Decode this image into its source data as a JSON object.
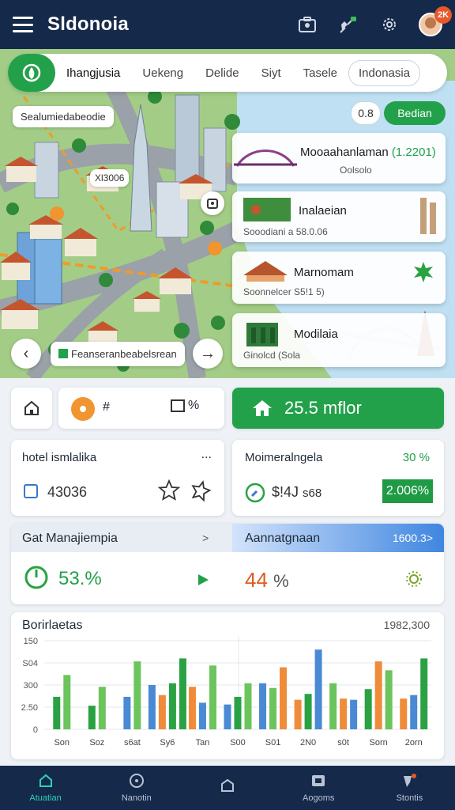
{
  "app": {
    "title": "Sldonoia"
  },
  "header": {
    "icons": [
      "briefcase-icon",
      "satellite-icon",
      "gear-icon"
    ],
    "avatar_badge": "2K"
  },
  "map": {
    "tabs": [
      "Ihangjusia",
      "Uekeng",
      "Delide",
      "Siyt",
      "Tasele",
      "Indonasia"
    ],
    "top_label": "Sealumiedabeodie",
    "marker_label": "Xl3006",
    "bottom_label": "Feanseranbeabelsrean",
    "pill_left": "0.8",
    "pill_right": "Bedian",
    "cards": [
      {
        "title": "Mooaahanlaman",
        "price": "(1.2201)",
        "sub": "Oolsolo"
      },
      {
        "title": "Inalaeian",
        "sub": "Sooodiani a 58.0.06"
      },
      {
        "title": "Marnomam",
        "sub": "Soonnelcer S5!1 5)"
      },
      {
        "title": "Modilaia",
        "sub": "Ginolcd (Sola"
      }
    ]
  },
  "quick": {
    "toolbar_a": "#",
    "toolbar_b": "%",
    "budget": "25.5 mflor"
  },
  "hotel_card": {
    "title": "hotel ismlalika",
    "more": "...",
    "code": "43036"
  },
  "metric_card": {
    "title": "Moimeralngela",
    "pct": "30 %",
    "price": "$!4J",
    "unit": "s68",
    "badge": "2.006%"
  },
  "stat_row": {
    "left_title": "Gat Manajiempia",
    "left_chev": ">",
    "left_value": "53.%",
    "right_title": "Aannatgnaan",
    "right_value": "1600.3",
    "right_chev": ">",
    "right_metric": "44",
    "right_unit": "%"
  },
  "chart": {
    "title": "Borirlaetas",
    "meta": "1982,300",
    "chart_data": {
      "type": "bar",
      "title": "Borirlaetas",
      "y_tick_labels": [
        "150",
        "S04",
        "300",
        "2.50",
        "0"
      ],
      "x_tick_labels": [
        "Son",
        "Soz",
        "s6at",
        "Sy6",
        "Tan",
        "S00",
        "S01",
        "2N0",
        "s0t",
        "Sorn",
        "2orn"
      ],
      "ylim": [
        0,
        150
      ],
      "colors": {
        "dark_green": "#2aa243",
        "light_green": "#6cc45c",
        "blue": "#4a89d4",
        "orange": "#ef8c3a"
      },
      "groups": [
        {
          "bars": [
            [
              "dark_green",
              55
            ],
            [
              "light_green",
              92
            ]
          ]
        },
        {
          "bars": [
            [
              "dark_green",
              40
            ],
            [
              "light_green",
              72
            ]
          ]
        },
        {
          "bars": [
            [
              "blue",
              55
            ],
            [
              "light_green",
              115
            ]
          ]
        },
        {
          "bars": [
            [
              "blue",
              75
            ],
            [
              "orange",
              58
            ],
            [
              "dark_green",
              78
            ],
            [
              "dark_green",
              120
            ]
          ]
        },
        {
          "bars": [
            [
              "orange",
              72
            ],
            [
              "blue",
              45
            ],
            [
              "light_green",
              108
            ]
          ]
        },
        {
          "bars": [
            [
              "blue",
              42
            ],
            [
              "dark_green",
              55
            ],
            [
              "light_green",
              78
            ]
          ]
        },
        {
          "bars": [
            [
              "blue",
              78
            ],
            [
              "light_green",
              70
            ],
            [
              "orange",
              105
            ]
          ]
        },
        {
          "bars": [
            [
              "orange",
              50
            ],
            [
              "dark_green",
              60
            ],
            [
              "blue",
              135
            ]
          ]
        },
        {
          "bars": [
            [
              "light_green",
              78
            ],
            [
              "orange",
              52
            ],
            [
              "blue",
              50
            ]
          ]
        },
        {
          "bars": [
            [
              "dark_green",
              68
            ],
            [
              "orange",
              115
            ],
            [
              "light_green",
              100
            ]
          ]
        },
        {
          "bars": [
            [
              "orange",
              52
            ],
            [
              "blue",
              58
            ],
            [
              "dark_green",
              120
            ]
          ]
        }
      ]
    }
  },
  "bottom_nav": [
    {
      "label": "Atuatian",
      "icon": "home-icon",
      "active": true
    },
    {
      "label": "Nanotin",
      "icon": "compass-icon",
      "active": false
    },
    {
      "label": "",
      "icon": "bag-icon",
      "active": false
    },
    {
      "label": "Aogoms",
      "icon": "wallet-icon",
      "active": false
    },
    {
      "label": "Stontis",
      "icon": "pin-icon",
      "active": false
    }
  ],
  "colors": {
    "navy": "#15294a",
    "green": "#22a14a",
    "orange": "#e8572b",
    "teal": "#2fd0b5"
  }
}
